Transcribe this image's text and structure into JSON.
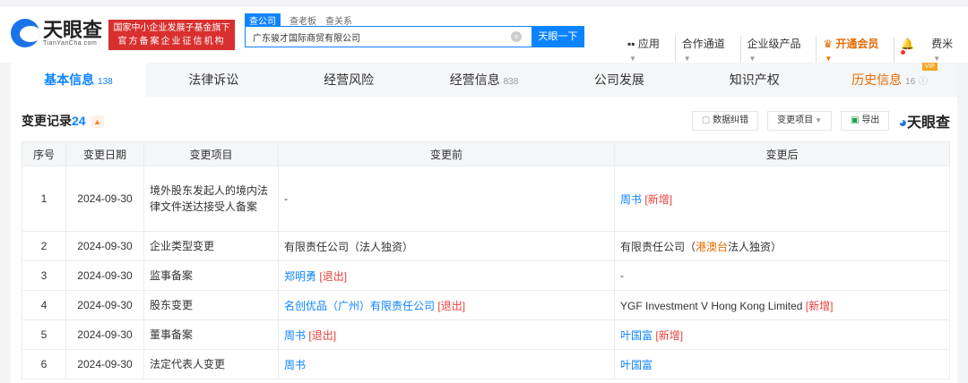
{
  "header": {
    "logo_cn": "天眼查",
    "logo_en": "TianYanCha.com",
    "badge_line1": "国家中小企业发展子基金旗下",
    "badge_line2": "官方备案企业征信机构",
    "search_tabs": [
      "查公司",
      "查老板",
      "查关系"
    ],
    "search_value": "广东骏才国际商贸有限公司",
    "search_button": "天眼一下",
    "nav": [
      "应用",
      "合作通道",
      "企业级产品",
      "开通会员",
      "费米"
    ]
  },
  "tabs": [
    {
      "label": "基本信息",
      "count": "138"
    },
    {
      "label": "法律诉讼",
      "count": ""
    },
    {
      "label": "经营风险",
      "count": ""
    },
    {
      "label": "经营信息",
      "count": "838"
    },
    {
      "label": "公司发展",
      "count": ""
    },
    {
      "label": "知识产权",
      "count": ""
    },
    {
      "label": "历史信息",
      "count": "16",
      "badge": "VIP"
    }
  ],
  "section": {
    "title": "变更记录",
    "count": "24",
    "tools": [
      "数据纠错",
      "变更项目",
      "导出"
    ],
    "brand": "天眼查"
  },
  "table": {
    "headers": [
      "序号",
      "变更日期",
      "变更项目",
      "变更前",
      "变更后"
    ],
    "rows": [
      {
        "no": "1",
        "date": "2024-09-30",
        "item": "境外股东发起人的境内法律文件送达接受人备案",
        "before": "-",
        "before_tag": "",
        "after": "周书",
        "after_tag": "[新增]"
      },
      {
        "no": "2",
        "date": "2024-09-30",
        "item": "企业类型变更",
        "before": "有限责任公司（法人独资）",
        "before_tag": "",
        "after": "有限责任公司（港澳台法人独资）",
        "after_tag": ""
      },
      {
        "no": "3",
        "date": "2024-09-30",
        "item": "监事备案",
        "before": "郑明勇",
        "before_tag": "[退出]",
        "after": "-",
        "after_tag": ""
      },
      {
        "no": "4",
        "date": "2024-09-30",
        "item": "股东变更",
        "before": "名创优品（广州）有限责任公司",
        "before_tag": "[退出]",
        "after": "YGF Investment V Hong Kong Limited",
        "after_tag": "[新增]"
      },
      {
        "no": "5",
        "date": "2024-09-30",
        "item": "董事备案",
        "before": "周书",
        "before_tag": "[退出]",
        "after": "叶国富",
        "after_tag": "[新增]"
      },
      {
        "no": "6",
        "date": "2024-09-30",
        "item": "法定代表人变更",
        "before": "周书",
        "before_tag": "",
        "after": "叶国富",
        "after_tag": ""
      }
    ]
  }
}
